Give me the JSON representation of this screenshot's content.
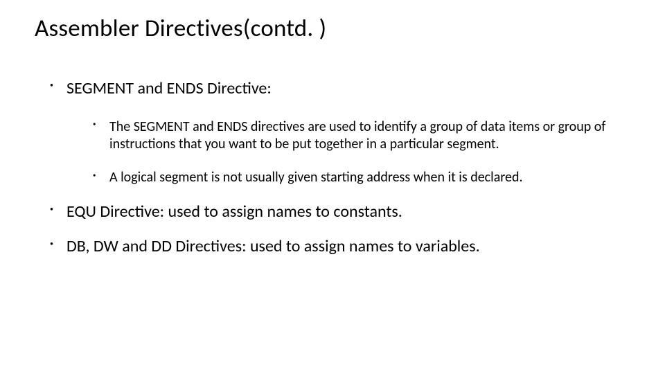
{
  "title": "Assembler Directives(contd. )",
  "bullets": {
    "b1": {
      "text": "SEGMENT and ENDS Directive:",
      "sub": {
        "s1": "The SEGMENT and ENDS directives are used to identify a group of data items or group of instructions that you want to be put together in a particular segment.",
        "s2": "A logical segment is not usually given starting address when it is declared."
      }
    },
    "b2": {
      "text": "EQU Directive: used to assign names to constants."
    },
    "b3": {
      "text": "DB, DW and DD Directives: used to assign names to variables."
    }
  }
}
